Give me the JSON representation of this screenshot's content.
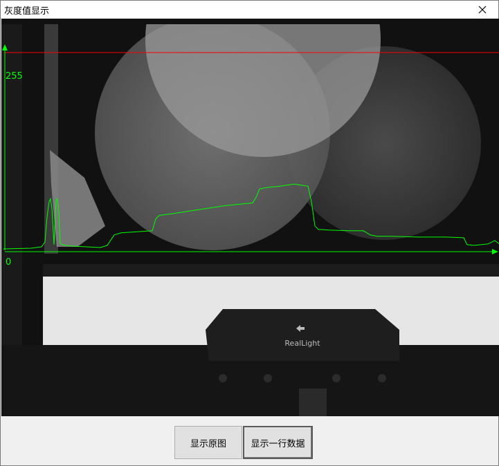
{
  "window": {
    "title": "灰度值显示",
    "close_icon": "close-icon"
  },
  "image_view": {
    "description_icon": "camera-image",
    "logo_text": "RealLight",
    "y_axis_max_label": "255",
    "y_axis_min_label": "0",
    "colors": {
      "axis": "#00ff00",
      "profile_line": "#00ff00",
      "scan_line": "#ff0000"
    }
  },
  "buttons": {
    "show_original": "显示原图",
    "show_row_data": "显示一行数据"
  },
  "chart_data": {
    "type": "line",
    "title": "",
    "xlabel": "",
    "ylabel": "",
    "ylim": [
      0,
      255
    ],
    "series": [
      {
        "x": [
          0,
          40,
          55,
          60,
          63,
          66,
          68,
          70,
          73,
          76,
          78,
          80,
          82,
          85,
          90,
          100,
          120,
          140,
          150,
          160,
          170,
          200,
          215,
          220,
          225,
          240,
          260,
          280,
          300,
          320,
          340,
          360,
          365,
          370,
          380,
          400,
          420,
          440,
          445,
          450,
          455,
          470,
          500,
          520,
          530,
          540,
          560,
          600,
          640,
          665,
          670,
          680,
          700,
          710,
          718
        ],
        "values": [
          2,
          3,
          5,
          12,
          48,
          70,
          74,
          60,
          8,
          72,
          74,
          55,
          10,
          8,
          7,
          6,
          5,
          4,
          7,
          22,
          25,
          27,
          28,
          45,
          50,
          52,
          55,
          58,
          61,
          64,
          66,
          68,
          76,
          88,
          90,
          92,
          95,
          92,
          70,
          35,
          30,
          29,
          28,
          28,
          22,
          20,
          20,
          19,
          19,
          18,
          8,
          7,
          9,
          14,
          8
        ]
      }
    ]
  }
}
